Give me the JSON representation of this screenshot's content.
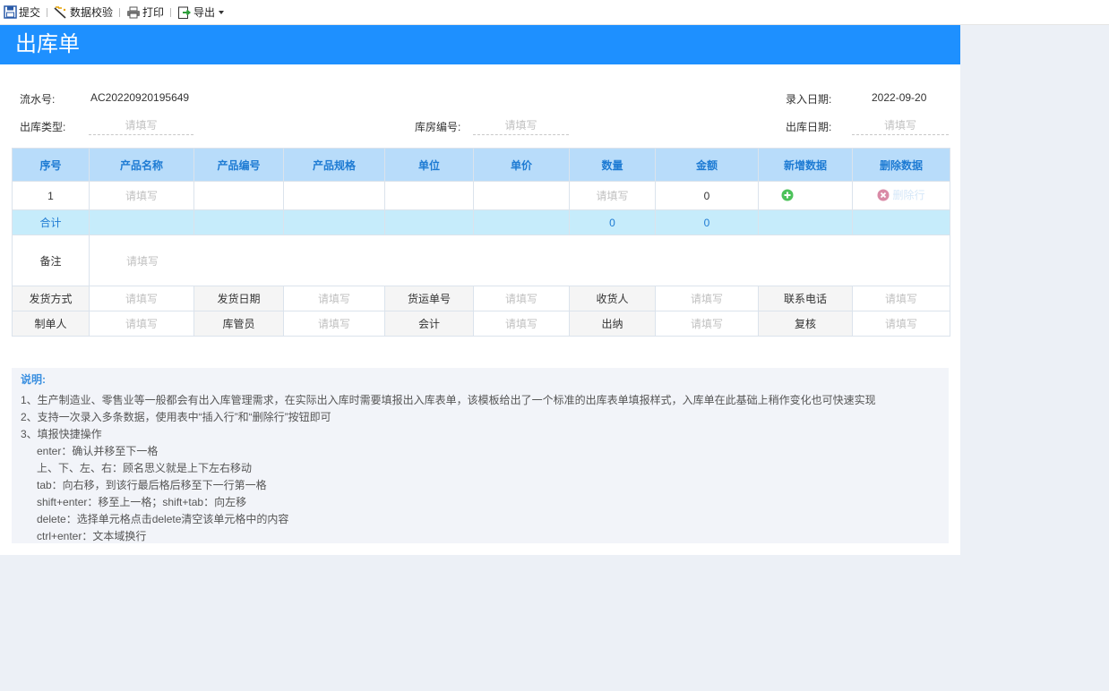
{
  "toolbar": {
    "submit": "提交",
    "validate": "数据校验",
    "print": "打印",
    "export": "导出"
  },
  "form": {
    "title": "出库单",
    "serial_label": "流水号:",
    "serial_value": "AC20220920195649",
    "entry_date_label": "录入日期:",
    "entry_date_value": "2022-09-20",
    "out_type_label": "出库类型:",
    "warehouse_no_label": "库房编号:",
    "out_date_label": "出库日期:",
    "placeholder": "请填写"
  },
  "table": {
    "headers": [
      "序号",
      "产品名称",
      "产品编号",
      "产品规格",
      "单位",
      "单价",
      "数量",
      "金额",
      "新增数据",
      "删除数据"
    ],
    "rows": [
      {
        "index": "1",
        "amount": "0"
      }
    ],
    "insert_label": "插入行",
    "delete_label": "删除行",
    "total_label": "合计",
    "total_qty": "0",
    "total_amount": "0",
    "note_label": "备注",
    "footer1": [
      "发货方式",
      "发货日期",
      "货运单号",
      "收货人",
      "联系电话"
    ],
    "footer2": [
      "制单人",
      "库管员",
      "会计",
      "出纳",
      "复核"
    ]
  },
  "notes": {
    "title": "说明:",
    "lines": [
      "1、生产制造业、零售业等一般都会有出入库管理需求，在实际出入库时需要填报出入库表单，该模板给出了一个标准的出库表单填报样式，入库单在此基础上稍作变化也可快速实现",
      "2、支持一次录入多条数据，使用表中“插入行”和“删除行”按钮即可",
      "3、填报快捷操作",
      "enter：确认并移至下一格",
      "上、下、左、右：顾名思义就是上下左右移动",
      "tab：向右移，到该行最后格后移至下一行第一格",
      "shift+enter：移至上一格；shift+tab：向左移",
      "delete：选择单元格点击delete清空该单元格中的内容",
      "ctrl+enter：文本域换行"
    ]
  },
  "colors": {
    "title_bar": "#1e90ff",
    "header_bg": "#b8dcfa",
    "header_text": "#1e7bd3",
    "sum_row": "#c6ecfb",
    "insert_btn": "#3d9ff2",
    "page_bg": "#ecf0f6"
  },
  "icons": [
    "save-icon",
    "validate-icon",
    "print-icon",
    "export-icon",
    "plus-circle-icon",
    "close-circle-icon"
  ]
}
